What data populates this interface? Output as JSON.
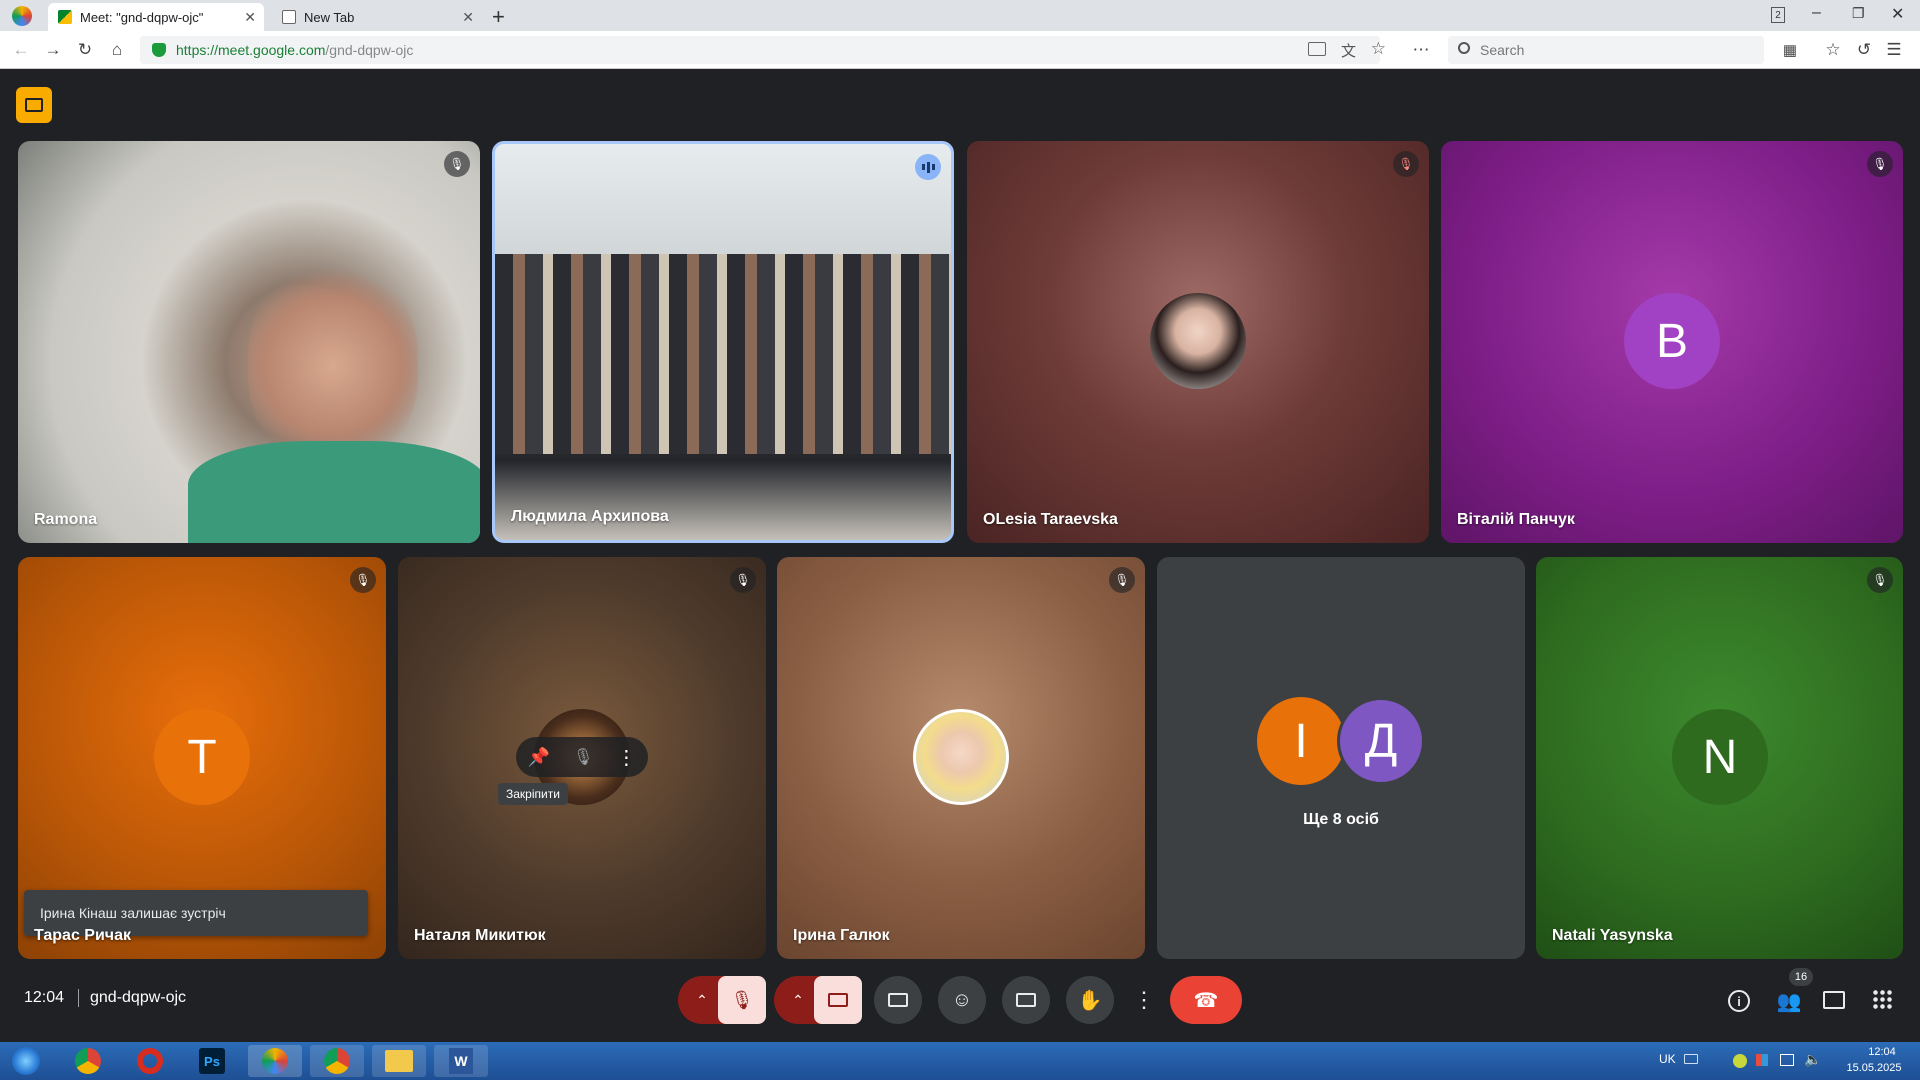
{
  "browser": {
    "tabs": [
      {
        "label": "Meet: \"gnd-dqpw-ojc\"",
        "active": true
      },
      {
        "label": "New Tab",
        "active": false
      }
    ],
    "window_badge": "2",
    "url_host": "https://meet.google.com",
    "url_path": "/gnd-dqpw-ojc",
    "search_placeholder": "Search"
  },
  "meet": {
    "participants_top": [
      {
        "name": "Ramona",
        "muted": true
      },
      {
        "name": "Людмила Архипова",
        "speaking": true
      },
      {
        "name": "OLesia Taraevska",
        "muted": true
      },
      {
        "name": "Віталій Панчук",
        "initial": "В",
        "muted": true
      }
    ],
    "participants_bottom": [
      {
        "name": "Тарас Ричак",
        "initial": "Т",
        "muted": true
      },
      {
        "name": "Наталя Микитюк",
        "muted": true
      },
      {
        "name": "Ірина Галюк",
        "muted": true
      },
      {
        "others_initials": [
          "І",
          "Д"
        ],
        "others_label": "Ще 8 осіб"
      },
      {
        "name": "Natali Yasynska",
        "initial": "N",
        "muted": true
      }
    ],
    "toast": "Ірина Кінаш залишає зустріч",
    "tooltip_pin": "Закріпити",
    "time": "12:04",
    "meeting_code": "gnd-dqpw-ojc",
    "people_count": "16"
  },
  "taskbar": {
    "lang": "UK",
    "clock_time": "12:04",
    "clock_date": "15.05.2025"
  },
  "colors": {
    "orange": "#e8710a",
    "purple_avatar": "#a142c4",
    "green_avatar": "#2e6b1f",
    "end_call": "#ea4335",
    "speaking_border": "#a8c7fa"
  }
}
